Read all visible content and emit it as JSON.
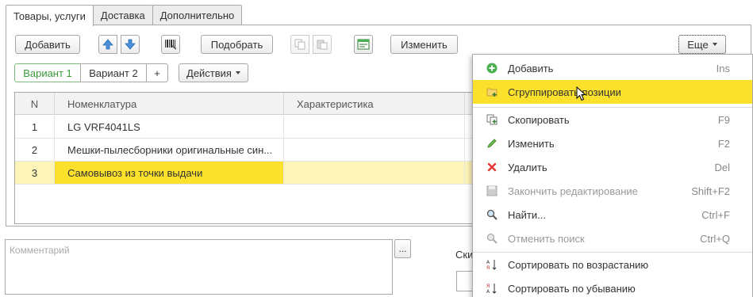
{
  "tabs": [
    "Товары, услуги",
    "Доставка",
    "Дополнительно"
  ],
  "toolbar": {
    "add_label": "Добавить",
    "pick_label": "Подобрать",
    "edit_label": "Изменить",
    "more_label": "Еще"
  },
  "variants": {
    "variant1": "Вариант 1",
    "variant2": "Вариант 2",
    "add": "+",
    "actions": "Действия"
  },
  "table": {
    "columns": [
      "N",
      "Номенклатура",
      "Характеристика"
    ],
    "rows": [
      {
        "n": "1",
        "item": "LG VRF4041LS",
        "char": ""
      },
      {
        "n": "2",
        "item": "Мешки-пылесборники оригинальные син...",
        "char": ""
      },
      {
        "n": "3",
        "item": "Самовывоз из точки выдачи",
        "char": ""
      }
    ]
  },
  "comment": {
    "placeholder": "Комментарий",
    "dots": "..."
  },
  "discount_label_partial": "Ски",
  "menu": {
    "items": [
      {
        "label": "Добавить",
        "shortcut": "Ins",
        "icon": "add-icon"
      },
      {
        "label": "Сгруппировать позиции",
        "shortcut": "",
        "icon": "group-icon"
      },
      {
        "label": "Скопировать",
        "shortcut": "F9",
        "icon": "copy-icon"
      },
      {
        "label": "Изменить",
        "shortcut": "F2",
        "icon": "pencil-icon"
      },
      {
        "label": "Удалить",
        "shortcut": "Del",
        "icon": "delete-icon"
      },
      {
        "label": "Закончить редактирование",
        "shortcut": "Shift+F2",
        "icon": "save-icon"
      },
      {
        "label": "Найти...",
        "shortcut": "Ctrl+F",
        "icon": "search-icon"
      },
      {
        "label": "Отменить поиск",
        "shortcut": "Ctrl+Q",
        "icon": "cancel-search-icon"
      },
      {
        "label": "Сортировать по возрастанию",
        "shortcut": "",
        "icon": "sort-asc-icon"
      },
      {
        "label": "Сортировать по убыванию",
        "shortcut": "",
        "icon": "sort-desc-icon"
      }
    ]
  },
  "colors": {
    "highlight": "#fbe12c",
    "selected_row": "#fdf4b8",
    "variant_active": "#3a9a3a"
  }
}
